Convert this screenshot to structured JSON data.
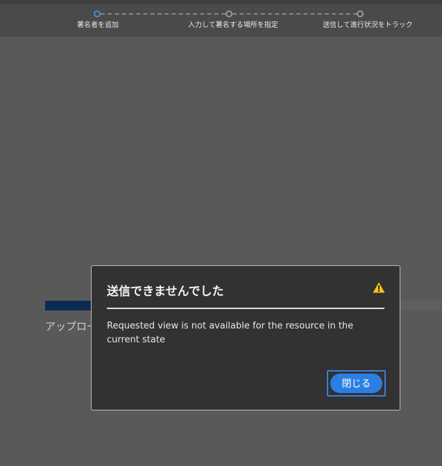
{
  "steps": [
    {
      "label": "署名者を追加",
      "active": true
    },
    {
      "label": "入力して署名する場所を指定",
      "active": false
    },
    {
      "label": "送信して進行状況をトラック",
      "active": false
    }
  ],
  "background": {
    "upload_text": "アップロー"
  },
  "dialog": {
    "title": "送信できませんでした",
    "icon": "warning-icon",
    "message": "Requested view is not available for the resource in the current state",
    "close_label": "閉じる"
  },
  "colors": {
    "accent": "#2b7fe3",
    "warning": "#f5c518",
    "dialog_bg": "#323232"
  }
}
